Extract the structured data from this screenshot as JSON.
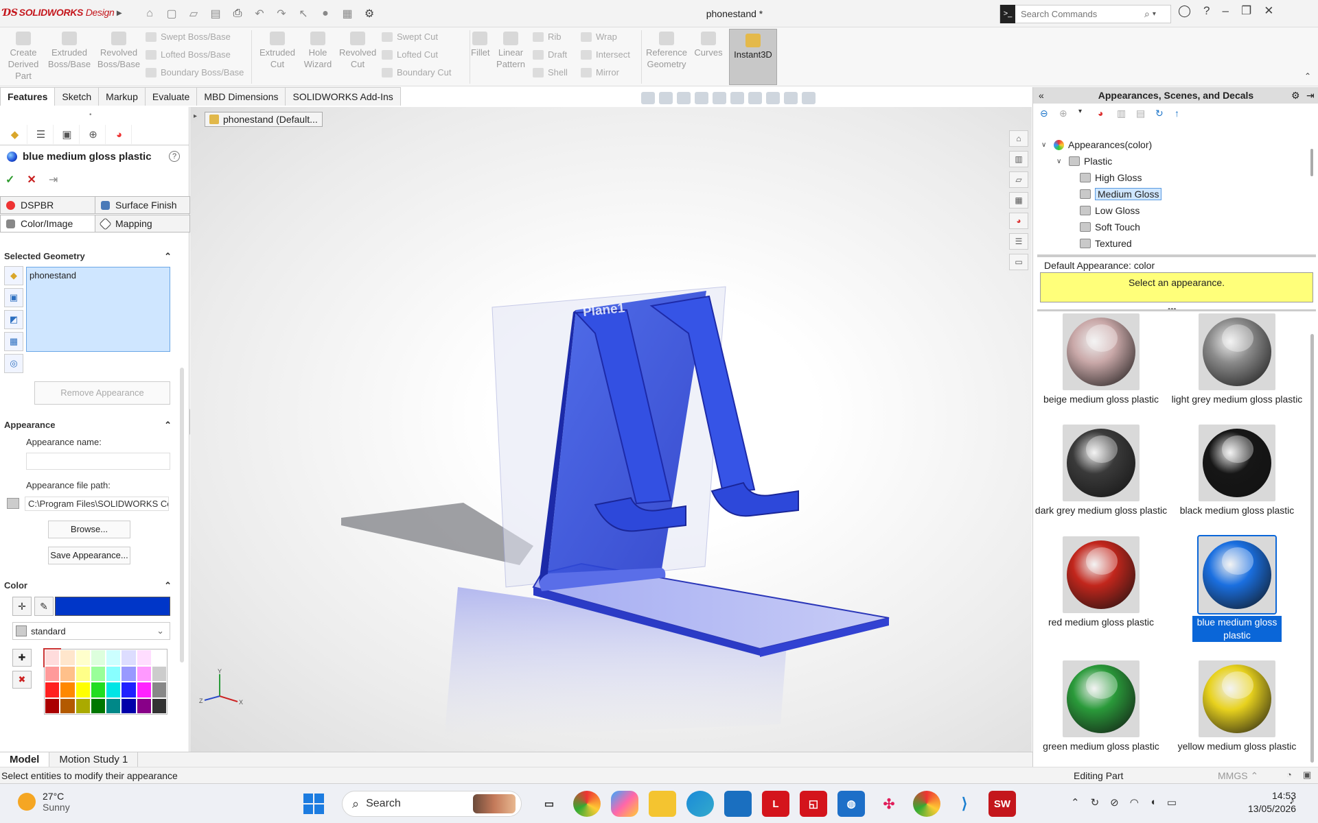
{
  "app": {
    "brand": "SOLIDWORKS",
    "brand_suffix": "Design",
    "doc_title": "phonestand *"
  },
  "search": {
    "placeholder": "Search Commands"
  },
  "ribbon": {
    "create_derived": "Create Derived Part",
    "extruded_boss": "Extruded Boss/Base",
    "revolved_boss": "Revolved Boss/Base",
    "swept_boss": "Swept Boss/Base",
    "lofted_boss": "Lofted Boss/Base",
    "boundary_boss": "Boundary Boss/Base",
    "extruded_cut": "Extruded Cut",
    "hole_wizard": "Hole Wizard",
    "revolved_cut": "Revolved Cut",
    "swept_cut": "Swept Cut",
    "lofted_cut": "Lofted Cut",
    "boundary_cut": "Boundary Cut",
    "fillet": "Fillet",
    "linear_pattern": "Linear Pattern",
    "rib": "Rib",
    "draft": "Draft",
    "shell": "Shell",
    "wrap": "Wrap",
    "intersect": "Intersect",
    "mirror": "Mirror",
    "reference_geometry": "Reference Geometry",
    "curves": "Curves",
    "instant3d": "Instant3D"
  },
  "tabs": [
    "Features",
    "Sketch",
    "Markup",
    "Evaluate",
    "MBD Dimensions",
    "SOLIDWORKS Add-Ins"
  ],
  "property_manager": {
    "title": "blue medium gloss plastic",
    "subtab_dspbr": "DSPBR",
    "subtab_surface": "Surface Finish",
    "subtab_color": "Color/Image",
    "subtab_mapping": "Mapping",
    "selected_geometry_title": "Selected Geometry",
    "selected_item": "phonestand",
    "remove_btn": "Remove Appearance",
    "appearance_title": "Appearance",
    "appearance_name_label": "Appearance name:",
    "appearance_name_value": "",
    "file_path_label": "Appearance file path:",
    "file_path_value": "C:\\Program Files\\SOLIDWORKS Co",
    "browse_btn": "Browse...",
    "save_btn": "Save Appearance...",
    "color_title": "Color",
    "color_value": "#0036c8",
    "palette_select": "standard"
  },
  "viewport": {
    "tree_label": "phonestand (Default...",
    "plane_label": "Plane1"
  },
  "right_panel": {
    "title": "Appearances, Scenes, and Decals",
    "tree_root": "Appearances(color)",
    "tree_folder": "Plastic",
    "tree_items": [
      "High Gloss",
      "Medium Gloss",
      "Low Gloss",
      "Soft Touch",
      "Textured"
    ],
    "selected_tree_item": "Medium Gloss",
    "default_appearance": "Default Appearance: color",
    "select_prompt": "Select an appearance.",
    "swatches": [
      {
        "label": "beige medium gloss plastic",
        "color": "#c9a8a8"
      },
      {
        "label": "light grey medium gloss plastic",
        "color": "#8a8a8a"
      },
      {
        "label": "dark grey medium gloss plastic",
        "color": "#3a3a3a"
      },
      {
        "label": "black medium gloss plastic",
        "color": "#161616"
      },
      {
        "label": "red medium gloss plastic",
        "color": "#c2261c"
      },
      {
        "label": "blue medium gloss plastic",
        "color": "#1a6fe0"
      },
      {
        "label": "green medium gloss plastic",
        "color": "#2a9a3a"
      },
      {
        "label": "yellow medium gloss plastic",
        "color": "#e8d21e"
      }
    ],
    "selected_swatch": "blue medium gloss plastic"
  },
  "model_tabs": [
    "Model",
    "Motion Study 1"
  ],
  "status": {
    "left": "Select entities to modify their appearance",
    "mode": "Editing Part",
    "units": "MMGS"
  },
  "taskbar": {
    "temp": "27°C",
    "weather": "Sunny",
    "search": "Search",
    "time": "14:53",
    "date": "13/05/2026"
  }
}
